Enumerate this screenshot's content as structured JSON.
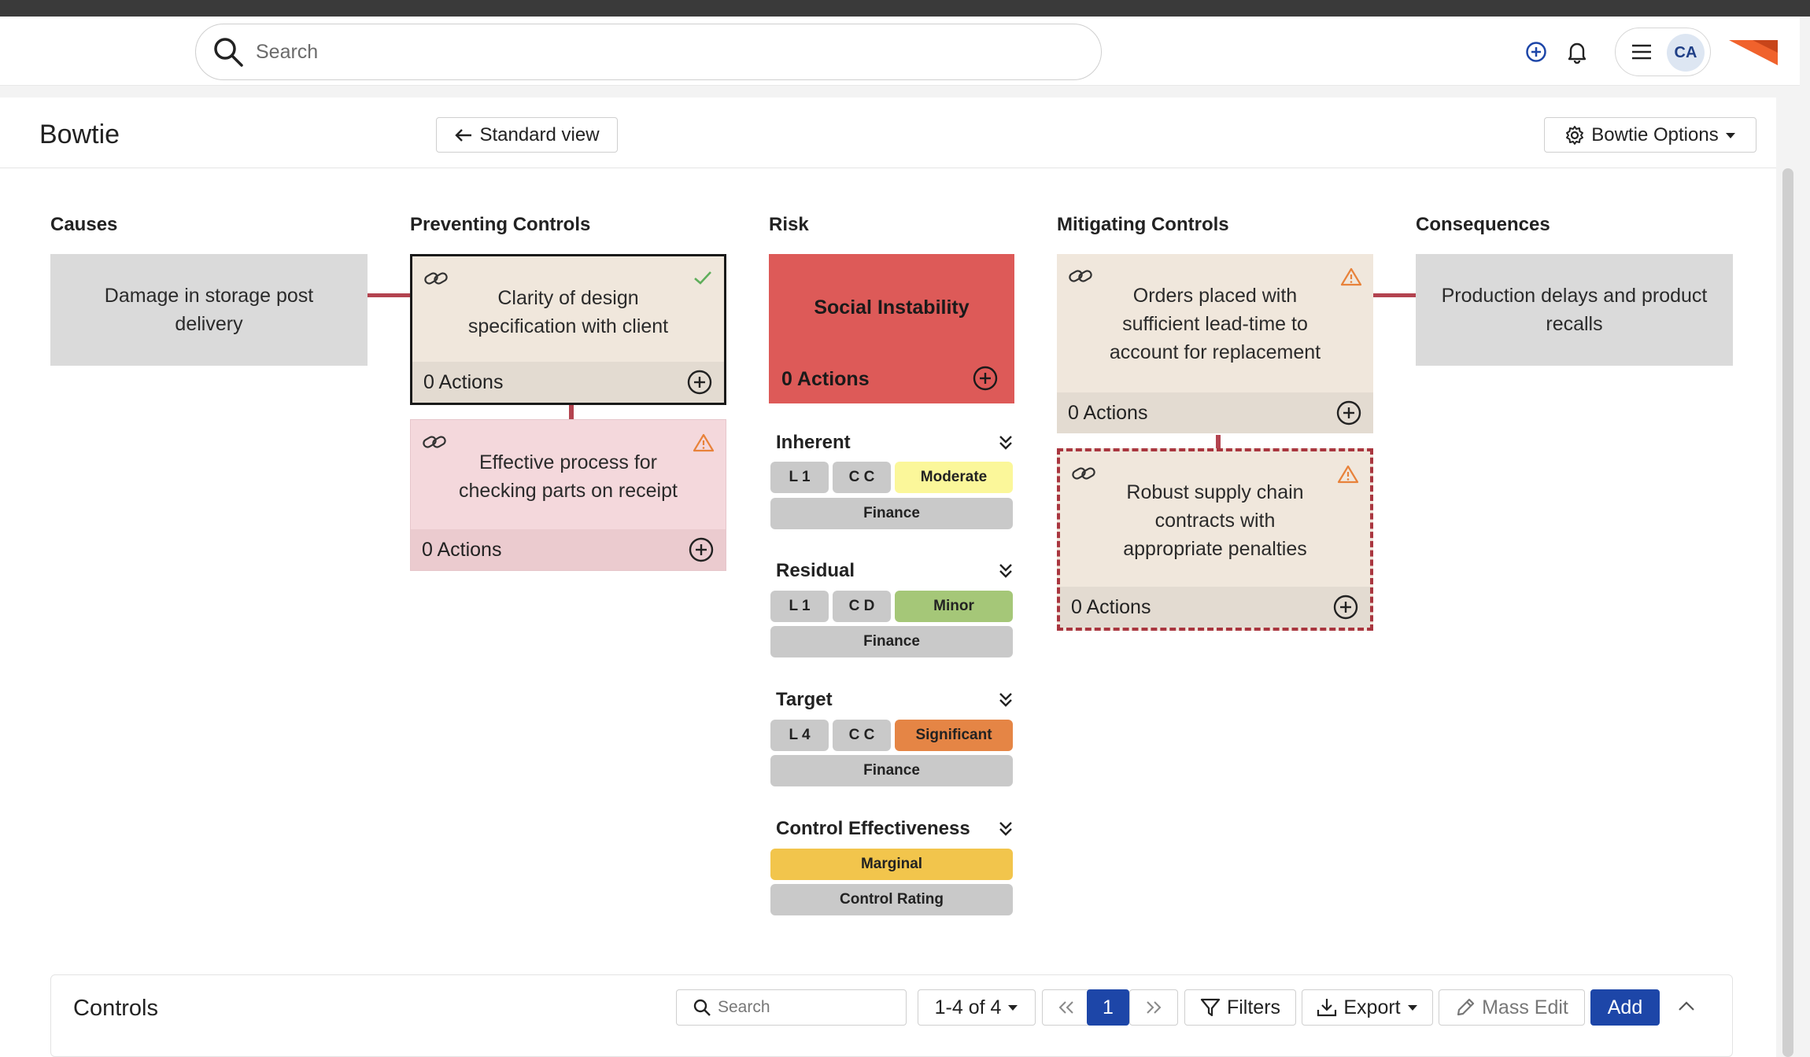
{
  "header": {
    "search_placeholder": "Search",
    "avatar_initials": "CA",
    "colors": {
      "accent": "#1d46a8",
      "brand": "#f0622c"
    }
  },
  "page": {
    "title": "Bowtie",
    "standard_view_label": "Standard view",
    "options_label": "Bowtie Options"
  },
  "bowtie": {
    "columns": {
      "causes": "Causes",
      "preventing": "Preventing Controls",
      "risk": "Risk",
      "mitigating": "Mitigating Controls",
      "consequences": "Consequences"
    },
    "cause": "Damage in storage post delivery",
    "preventing_controls": [
      {
        "title": "Clarity of design specification with client",
        "actions": "0 Actions",
        "status": "check-icon"
      },
      {
        "title": "Effective process for checking parts on receipt",
        "actions": "0 Actions",
        "status": "warning-icon"
      }
    ],
    "risk": {
      "title": "Social Instability",
      "actions": "0 Actions",
      "color": "#dd5a58"
    },
    "mitigating_controls": [
      {
        "title": "Orders placed with sufficient lead-time to account for replacement",
        "actions": "0 Actions",
        "status": "warning-icon"
      },
      {
        "title": "Robust supply chain contracts with appropriate penalties",
        "actions": "0 Actions",
        "status": "warning-icon"
      }
    ],
    "consequence": "Production delays and product recalls",
    "ratings": {
      "inherent": {
        "label": "Inherent",
        "likelihood": "L 1",
        "consequence": "C C",
        "rating": "Moderate",
        "rating_color": "#fbf79a",
        "category": "Finance"
      },
      "residual": {
        "label": "Residual",
        "likelihood": "L 1",
        "consequence": "C D",
        "rating": "Minor",
        "rating_color": "#a5c778",
        "category": "Finance"
      },
      "target": {
        "label": "Target",
        "likelihood": "L 4",
        "consequence": "C C",
        "rating": "Significant",
        "rating_color": "#e58545",
        "category": "Finance"
      },
      "effectiveness": {
        "label": "Control Effectiveness",
        "rating": "Marginal",
        "rating_color": "#f2c54c",
        "sub": "Control Rating"
      }
    }
  },
  "controls_panel": {
    "title": "Controls",
    "search_placeholder": "Search",
    "range": "1-4 of 4",
    "page": "1",
    "filters": "Filters",
    "export": "Export",
    "mass_edit": "Mass Edit",
    "add": "Add"
  }
}
